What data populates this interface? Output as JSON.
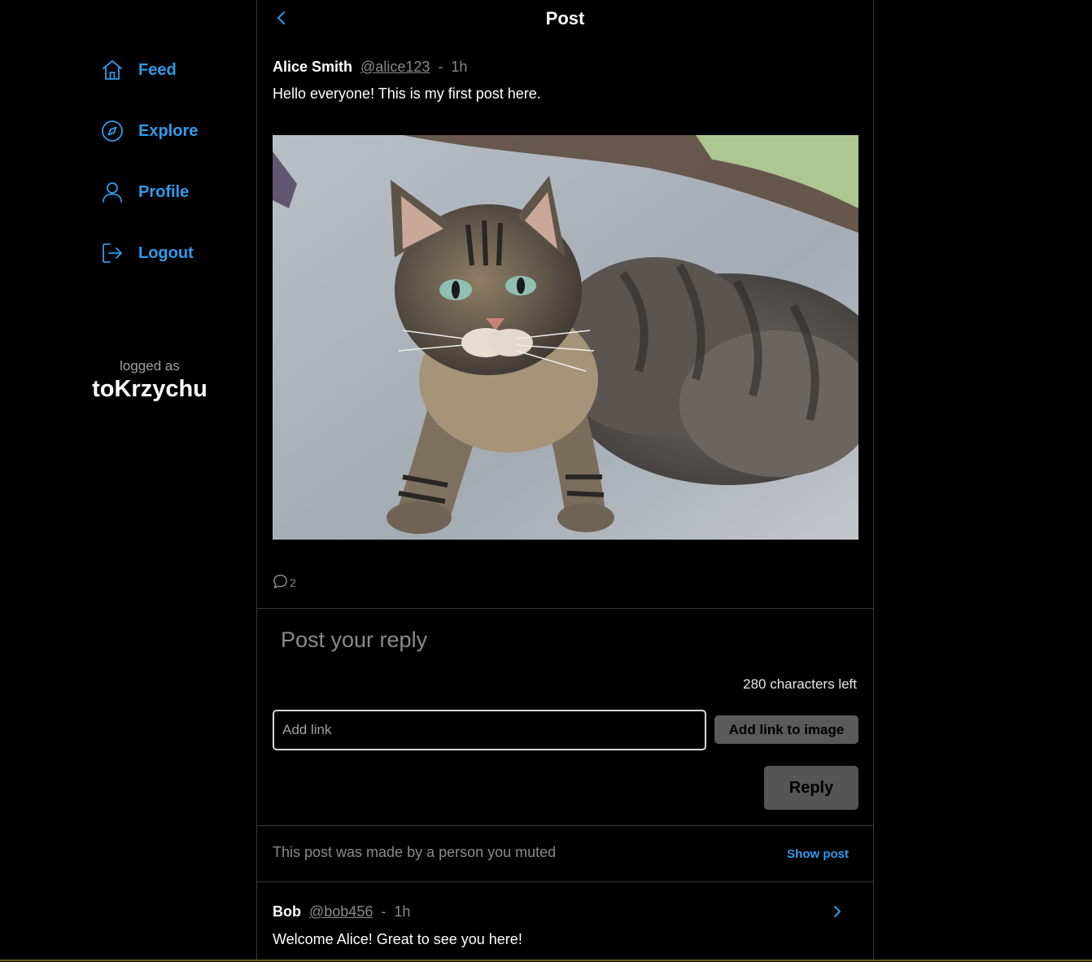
{
  "sidebar": {
    "items": [
      {
        "label": "Feed",
        "icon": "home-icon"
      },
      {
        "label": "Explore",
        "icon": "compass-icon"
      },
      {
        "label": "Profile",
        "icon": "user-icon"
      },
      {
        "label": "Logout",
        "icon": "logout-icon"
      }
    ],
    "logged_as_label": "logged as",
    "username": "toKrzychu"
  },
  "header": {
    "title": "Post",
    "back_icon": "chevron-left-icon"
  },
  "post": {
    "author_name": "Alice Smith",
    "author_handle": "@alice123",
    "separator": "-",
    "time": "1h",
    "text": "Hello everyone! This is my first post here.",
    "image_description_icon": "cat-photo",
    "comment_icon": "comment-bubble-icon",
    "comment_count": "2"
  },
  "reply_form": {
    "placeholder": "Post your reply",
    "chars_left": "280 characters left",
    "link_placeholder": "Add link",
    "add_link_label": "Add link to image",
    "reply_label": "Reply"
  },
  "muted": {
    "text": "This post was made by a person you muted",
    "show_label": "Show post"
  },
  "reply": {
    "author_name": "Bob",
    "author_handle": "@bob456",
    "separator": "-",
    "time": "1h",
    "text": "Welcome Alice! Great to see you here!"
  },
  "colors": {
    "accent": "#2f9bea",
    "background": "#000000",
    "muted_text": "#8a8a8a",
    "button_bg": "#555555"
  }
}
